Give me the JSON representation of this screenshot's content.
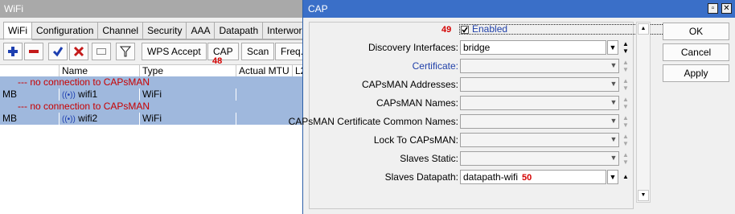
{
  "wifi": {
    "title": "WiFi",
    "tabs": [
      "WiFi",
      "Configuration",
      "Channel",
      "Security",
      "AAA",
      "Datapath",
      "Interworking"
    ],
    "toolbar": {
      "wps_label": "WPS Accept",
      "cap_label": "CAP",
      "scan_label": "Scan",
      "freq_label": "Freq.",
      "cap_callout": "48"
    },
    "columns": [
      "Name",
      "Type",
      "Actual MTU",
      "L2"
    ],
    "rows": [
      {
        "message": "--- no connection to CAPsMAN",
        "flag": "MB",
        "name": "wifi1",
        "type": "WiFi"
      },
      {
        "message": "--- no connection to CAPsMAN",
        "flag": "MB",
        "name": "wifi2",
        "type": "WiFi"
      }
    ]
  },
  "cap": {
    "title": "CAP",
    "enabled_callout": "49",
    "enabled_label": "Enabled",
    "enabled_checked": true,
    "fields": [
      {
        "label": "Discovery Interfaces:",
        "value": "bridge",
        "enabled": true
      },
      {
        "label": "Certificate:",
        "value": "",
        "enabled": false
      },
      {
        "label": "CAPsMAN Addresses:",
        "value": "",
        "enabled": false
      },
      {
        "label": "CAPsMAN Names:",
        "value": "",
        "enabled": false
      },
      {
        "label": "CAPsMAN Certificate Common Names:",
        "value": "",
        "enabled": false
      },
      {
        "label": "Lock To CAPsMAN:",
        "value": "",
        "enabled": false
      },
      {
        "label": "Slaves Static:",
        "value": "",
        "enabled": false
      },
      {
        "label": "Slaves Datapath:",
        "value": "datapath-wifi",
        "enabled": true
      }
    ],
    "datapath_callout": "50",
    "buttons": {
      "ok": "OK",
      "cancel": "Cancel",
      "apply": "Apply"
    },
    "colors": {
      "title_bar": "#3a6fc8",
      "callout": "#d40000",
      "link_label": "#1f3fa8"
    }
  }
}
